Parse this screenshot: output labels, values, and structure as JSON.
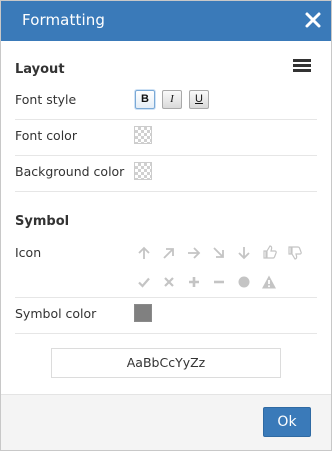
{
  "dialog": {
    "title": "Formatting",
    "close_icon": "close-icon"
  },
  "layout": {
    "section_title": "Layout",
    "menu_icon": "hamburger-menu-icon",
    "font_style_label": "Font style",
    "font_style_buttons": [
      {
        "label": "B",
        "name": "bold",
        "active": true
      },
      {
        "label": "I",
        "name": "italic",
        "active": false
      },
      {
        "label": "U",
        "name": "underline",
        "active": false
      }
    ],
    "font_color_label": "Font color",
    "font_color_value": "transparent",
    "background_color_label": "Background color",
    "background_color_value": "transparent"
  },
  "symbol": {
    "section_title": "Symbol",
    "icon_label": "Icon",
    "icons": [
      "arrow-up-icon",
      "arrow-up-right-icon",
      "arrow-right-icon",
      "arrow-down-right-icon",
      "arrow-down-icon",
      "thumbs-up-icon",
      "thumbs-down-icon",
      "check-icon",
      "cross-icon",
      "plus-icon",
      "minus-icon",
      "circle-icon",
      "warning-icon"
    ],
    "symbol_color_label": "Symbol color",
    "symbol_color_value": "#808080"
  },
  "preview": {
    "sample_text": "AaBbCcYyZz"
  },
  "footer": {
    "ok_label": "Ok"
  },
  "colors": {
    "accent": "#3a7ab9",
    "icon_gray": "#c4c4c4"
  }
}
